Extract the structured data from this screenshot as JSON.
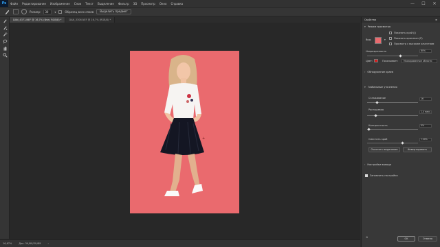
{
  "menu": {
    "logo": "Ps",
    "items": [
      "Файл",
      "Редактирование",
      "Изображение",
      "Слои",
      "Текст",
      "Выделение",
      "Фильтр",
      "3D",
      "Просмотр",
      "Окно",
      "Справка"
    ]
  },
  "window_controls": {
    "minimize": "—",
    "maximize": "☐",
    "close": "✕"
  },
  "options_bar": {
    "radius_label": "Размер:",
    "radius_value": "30",
    "sample_all_label": "Образец всех слоев",
    "select_subject_button": "Выделить предмет"
  },
  "tabs": [
    {
      "label": "DAN_4371.NEF @ 16,7% (Фон, RGB/8) *",
      "active": true
    },
    {
      "label": "DAN_3306.NEF @ 16,7% (RGB/8) *",
      "active": false
    }
  ],
  "tools": [
    "brush",
    "refine-edge-brush",
    "quick-selection",
    "lasso",
    "hand",
    "zoom"
  ],
  "status": {
    "zoom": "16,67%",
    "doc": "Док: 39,8M/39,8M"
  },
  "panel": {
    "title": "Свойства",
    "view_mode_label": "Режим просмотра",
    "view_label": "Вид:",
    "show_edge_label": "Показать край (J)",
    "show_original_label": "Показать оригинал (P)",
    "high_quality_label": "Просмотр с высоким качеством",
    "opacity_label": "Непрозрачность",
    "opacity_value": "80%",
    "color_label": "Цвет:",
    "indicates_label": "Показывает:",
    "indicates_value": "Маскированные области",
    "edge_detection_label": "Обнаружение краев",
    "global_refinements_label": "Глобальные уточнения",
    "smooth_label": "Сглаживание",
    "smooth_value": "16",
    "feather_label": "Растушевка",
    "feather_value": "1,4 пикс.",
    "contrast_label": "Контрастность",
    "contrast_value": "0%",
    "shift_edge_label": "Сместить край",
    "shift_edge_value": "+40%",
    "clear_selection_button": "Очистить выделение",
    "invert_button": "Инвертировать",
    "output_settings_label": "Настройки вывода",
    "remember_settings_label": "Запомнить настройки",
    "ok_button": "OK",
    "cancel_button": "Отмена"
  },
  "colors": {
    "photo_background": "#ea6a6e",
    "overlay_color": "#d41a1a",
    "accent": "#31a8ff"
  }
}
